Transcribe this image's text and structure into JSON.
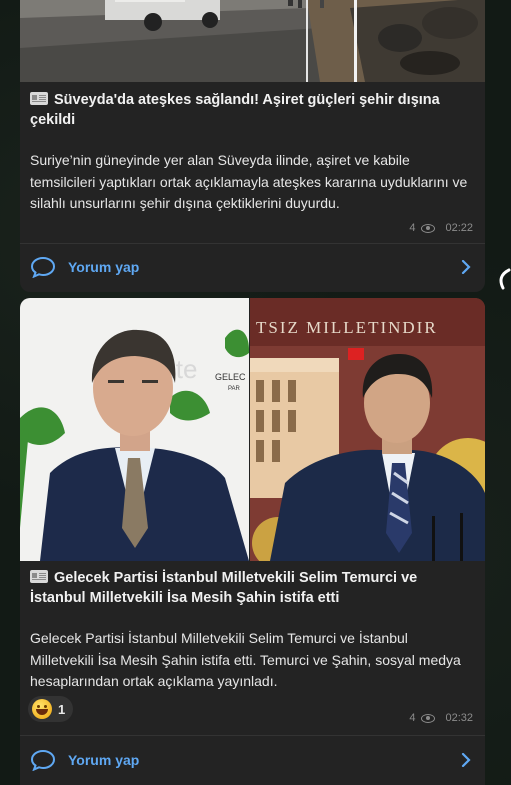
{
  "posts": [
    {
      "title": "Süveyda'da ateşkes sağlandı! Aşiret güçleri şehir dışına çekildi",
      "body": "Suriye’nin güneyinde yer alan Süveyda ilinde, aşiret ve kabile temsilcileri yaptıkları ortak açıklamayla ateşkes kararına uyduklarını ve silahlı unsurlarını şehir dışına çektiklerini duyurdu.",
      "views": "4",
      "time": "02:22",
      "comment_label": "Yorum yap"
    },
    {
      "title": "Gelecek Partisi İstanbul Milletvekili Selim Temurci ve İstanbul Milletvekili İsa Mesih Şahin istifa etti",
      "body": "Gelecek Partisi İstanbul Milletvekili Selim Temurci ve İstanbul Milletvekili İsa Mesih Şahin istifa etti. Temurci ve Şahin, sosyal medya hesaplarından ortak açıklama yayınladı.",
      "reaction_count": "1",
      "views": "4",
      "time": "02:32",
      "comment_label": "Yorum yap",
      "image_left_text": "GELEC",
      "image_left_sub": "PAR",
      "image_watermark": "ite",
      "image_banner": "TSIZ MILLETINDIR"
    }
  ],
  "colors": {
    "accent": "#5fa8f3",
    "card": "#232323",
    "background": "#121a15"
  }
}
